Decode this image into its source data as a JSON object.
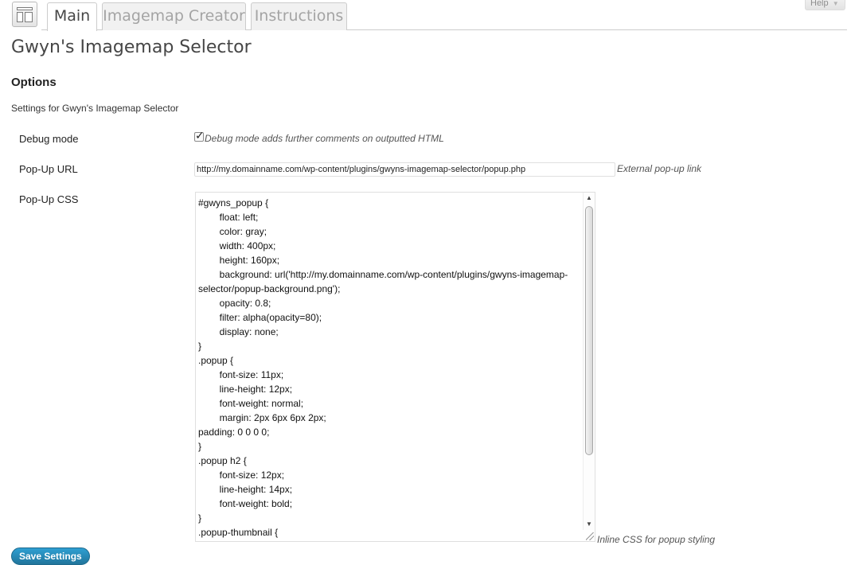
{
  "tabs": [
    {
      "label": "Main",
      "active": true
    },
    {
      "label": "Imagemap Creator",
      "active": false
    },
    {
      "label": "Instructions",
      "active": false
    }
  ],
  "help": {
    "label": "Help",
    "arrow": "▼"
  },
  "page": {
    "title": "Gwyn's Imagemap Selector",
    "section_title": "Options",
    "section_desc": "Settings for Gwyn's Imagemap Selector"
  },
  "debug": {
    "label": "Debug mode",
    "checked": true,
    "description": "Debug mode adds further comments on outputted HTML"
  },
  "popup_url": {
    "label": "Pop-Up URL",
    "value": "http://my.domainname.com/wp-content/plugins/gwyns-imagemap-selector/popup.php",
    "description": "External pop-up link"
  },
  "popup_css": {
    "label": "Pop-Up CSS",
    "value": "#gwyns_popup {\n\tfloat: left;\n\tcolor: gray;\n\twidth: 400px;\n\theight: 160px;\n\tbackground: url('http://my.domainname.com/wp-content/plugins/gwyns-imagemap-selector/popup-background.png');\n\topacity: 0.8;\n\tfilter: alpha(opacity=80);\n\tdisplay: none;\n}\n.popup {\n\tfont-size: 11px;\n\tline-height: 12px;\n\tfont-weight: normal;\n\tmargin: 2px 6px 6px 2px;\npadding: 0 0 0 0;\n}\n.popup h2 {\n\tfont-size: 12px;\n\tline-height: 14px;\n\tfont-weight: bold;\n}\n.popup-thumbnail {",
    "description": "Inline CSS for popup styling"
  },
  "save_button": {
    "label": "Save Settings"
  },
  "colors": {
    "accent": "#21759b",
    "tab_inactive_text": "#a4a4a4"
  },
  "icons": {
    "page": "layout-page-icon",
    "checkbox": "check-icon",
    "scroll_up": "arrow-up-icon",
    "scroll_down": "arrow-down-icon"
  }
}
